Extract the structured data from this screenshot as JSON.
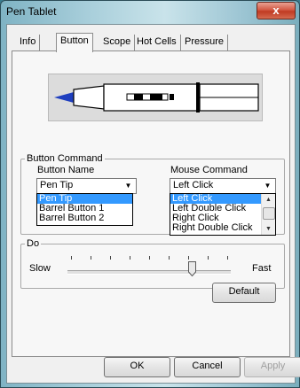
{
  "window": {
    "title": "Pen Tablet",
    "close_glyph": "x"
  },
  "tabs": [
    {
      "label": "Info"
    },
    {
      "label": "Button",
      "active": true
    },
    {
      "label": "Scope"
    },
    {
      "label": "Hot Cells"
    },
    {
      "label": "Pressure"
    }
  ],
  "button_command": {
    "group_label": "Button Command",
    "button_name_label": "Button Name",
    "mouse_command_label": "Mouse Command",
    "button_name_value": "Pen Tip",
    "mouse_command_value": "Left Click",
    "button_name_options": [
      "Pen Tip",
      "Barrel Button 1",
      "Barrel Button 2"
    ],
    "mouse_command_options": [
      "Left Click",
      "Left Double Click",
      "Right Click",
      "Right Double Click"
    ]
  },
  "double_click": {
    "group_label_visible": "Do",
    "slow_label": "Slow",
    "fast_label": "Fast"
  },
  "buttons": {
    "default": "Default",
    "ok": "OK",
    "cancel": "Cancel",
    "apply": "Apply"
  },
  "icons": {
    "close": "close-icon",
    "dropdown": "chevron-down-icon",
    "scroll_up": "chevron-up-icon",
    "scroll_down": "chevron-down-icon",
    "pen": "pen-illustration"
  },
  "colors": {
    "selection": "#3399ff",
    "close_button": "#c03a22",
    "pen_tip": "#1f3fbf"
  }
}
